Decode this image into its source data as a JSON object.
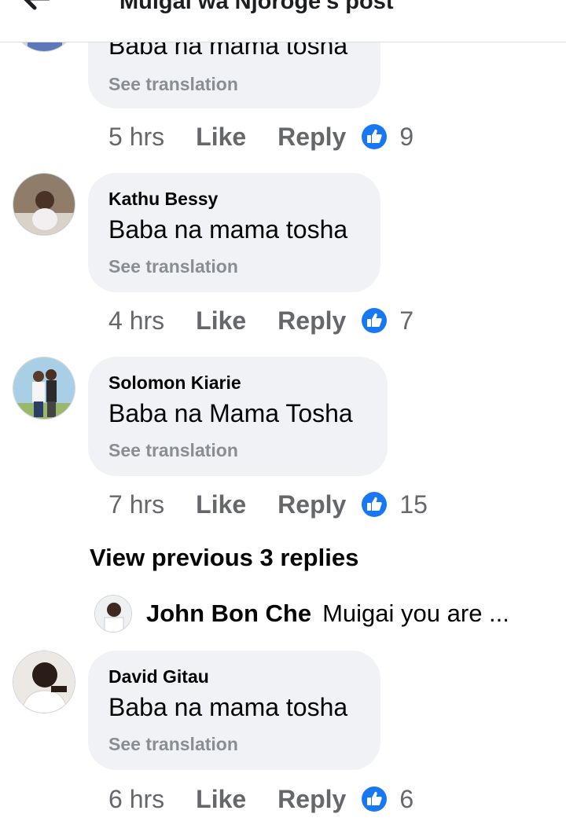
{
  "header": {
    "title": "Muigai wa Njoroge's post"
  },
  "comments": [
    {
      "author": "",
      "text": "Baba na mama tosha",
      "see_translation": "See translation",
      "time": "5 hrs",
      "like": "Like",
      "reply": "Reply",
      "reactions": "9"
    },
    {
      "author": "Kathu Bessy",
      "text": "Baba na mama tosha",
      "see_translation": "See translation",
      "time": "4 hrs",
      "like": "Like",
      "reply": "Reply",
      "reactions": "7"
    },
    {
      "author": "Solomon Kiarie",
      "text": "Baba na Mama Tosha",
      "see_translation": "See translation",
      "time": "7 hrs",
      "like": "Like",
      "reply": "Reply",
      "reactions": "15"
    },
    {
      "author": "David Gitau",
      "text": "Baba na mama tosha",
      "see_translation": "See translation",
      "time": "6 hrs",
      "like": "Like",
      "reply": "Reply",
      "reactions": "6"
    }
  ],
  "replies": {
    "view_previous": "View previous 3 replies",
    "latest": {
      "author": "John Bon Che",
      "preview": "Muigai you are ..."
    }
  },
  "colors": {
    "bubble": "#f0f2f5",
    "meta_text": "#65676b",
    "see_translation": "#8a8d91",
    "like_blue": "#1877f2"
  },
  "icons": {
    "back": "back-arrow-icon",
    "reaction": "like-reaction-icon"
  }
}
